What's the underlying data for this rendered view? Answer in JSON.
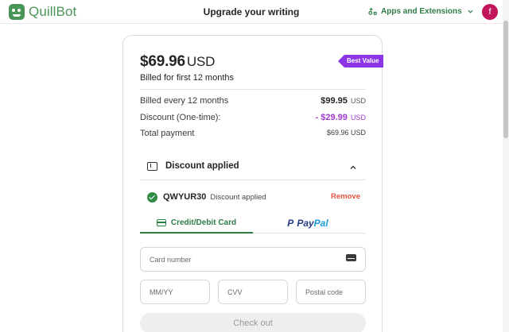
{
  "header": {
    "logo_text": "QuillBot",
    "title": "Upgrade your writing",
    "apps_label": "Apps and Extensions",
    "avatar_initial": "f"
  },
  "plan": {
    "price": "$69.96",
    "currency": "USD",
    "billing_note": "Billed for first 12 months",
    "badge": "Best Value"
  },
  "summary": {
    "rows": [
      {
        "label": "Billed every 12 months",
        "value": "$99.95",
        "unit": "USD"
      },
      {
        "label": "Discount (One-time):",
        "value": "- $29.99",
        "unit": "USD"
      },
      {
        "label": "Total payment",
        "value": "$69.96 USD"
      }
    ]
  },
  "discount": {
    "heading": "Discount applied",
    "code": "QWYUR30",
    "status": "Discount applied",
    "remove_label": "Remove"
  },
  "payment_tabs": {
    "card_label": "Credit/Debit Card",
    "paypal_pay": "Pay",
    "paypal_pal": "Pal",
    "paypal_mark": "P"
  },
  "form": {
    "card_number_placeholder": "Card number",
    "expiry_placeholder": "MM/YY",
    "cvv_placeholder": "CVV",
    "postal_placeholder": "Postal code",
    "checkout_label": "Check out"
  },
  "colors": {
    "brand_green": "#499557",
    "accent_green": "#2e7d44",
    "badge_purple": "#8c35e6",
    "discount_purple": "#a23ad0",
    "remove_red": "#e0533d",
    "paypal_dark": "#253b80",
    "paypal_light": "#179bd7",
    "avatar": "#c2185b"
  }
}
